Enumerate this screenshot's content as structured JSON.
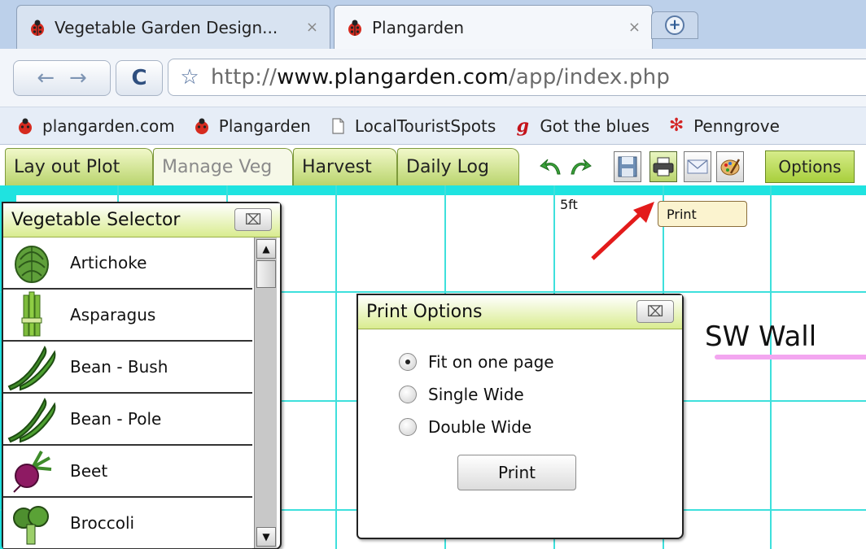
{
  "browser": {
    "tabs": [
      {
        "title": "Vegetable Garden Design...",
        "close": "×",
        "active": false
      },
      {
        "title": "Plangarden",
        "close": "×",
        "active": true
      }
    ],
    "url_scheme": "http://",
    "url_host": "www.plangarden.com",
    "url_path": "/app/index.php",
    "bookmarks": [
      {
        "label": "plangarden.com",
        "icon": "ladybug-icon"
      },
      {
        "label": "Plangarden",
        "icon": "ladybug-icon"
      },
      {
        "label": "LocalTouristSpots",
        "icon": "page-icon"
      },
      {
        "label": "Got the blues",
        "icon": "g-script-icon"
      },
      {
        "label": "Penngrove",
        "icon": "yelp-icon"
      }
    ]
  },
  "app": {
    "tabs": [
      {
        "label": "Lay out Plot",
        "active": false
      },
      {
        "label": "Manage Veg",
        "active": true
      },
      {
        "label": "Harvest",
        "active": false
      },
      {
        "label": "Daily Log",
        "active": false
      }
    ],
    "tools": [
      "undo-icon",
      "redo-icon",
      "save-icon",
      "print-icon",
      "email-icon",
      "palette-icon"
    ],
    "options_label": "Options",
    "tooltip": "Print"
  },
  "plot": {
    "ruler_label": "5ft",
    "wall_label": "SW Wall"
  },
  "veg_selector": {
    "title": "Vegetable Selector",
    "close": "⌧",
    "items": [
      {
        "name": "Artichoke",
        "icon": "artichoke-icon"
      },
      {
        "name": "Asparagus",
        "icon": "asparagus-icon"
      },
      {
        "name": "Bean - Bush",
        "icon": "bean-icon"
      },
      {
        "name": "Bean - Pole",
        "icon": "bean-icon"
      },
      {
        "name": "Beet",
        "icon": "beet-icon"
      },
      {
        "name": "Broccoli",
        "icon": "broccoli-icon"
      }
    ]
  },
  "print_options": {
    "title": "Print Options",
    "close": "⌧",
    "options": [
      {
        "label": "Fit on one page",
        "checked": true
      },
      {
        "label": "Single Wide",
        "checked": false
      },
      {
        "label": "Double Wide",
        "checked": false
      }
    ],
    "button": "Print"
  },
  "colors": {
    "grid": "#3ee0dc",
    "panel_header": "#d9ec8f",
    "wall_line": "#f3a6f0",
    "arrow": "#e31b1b"
  }
}
